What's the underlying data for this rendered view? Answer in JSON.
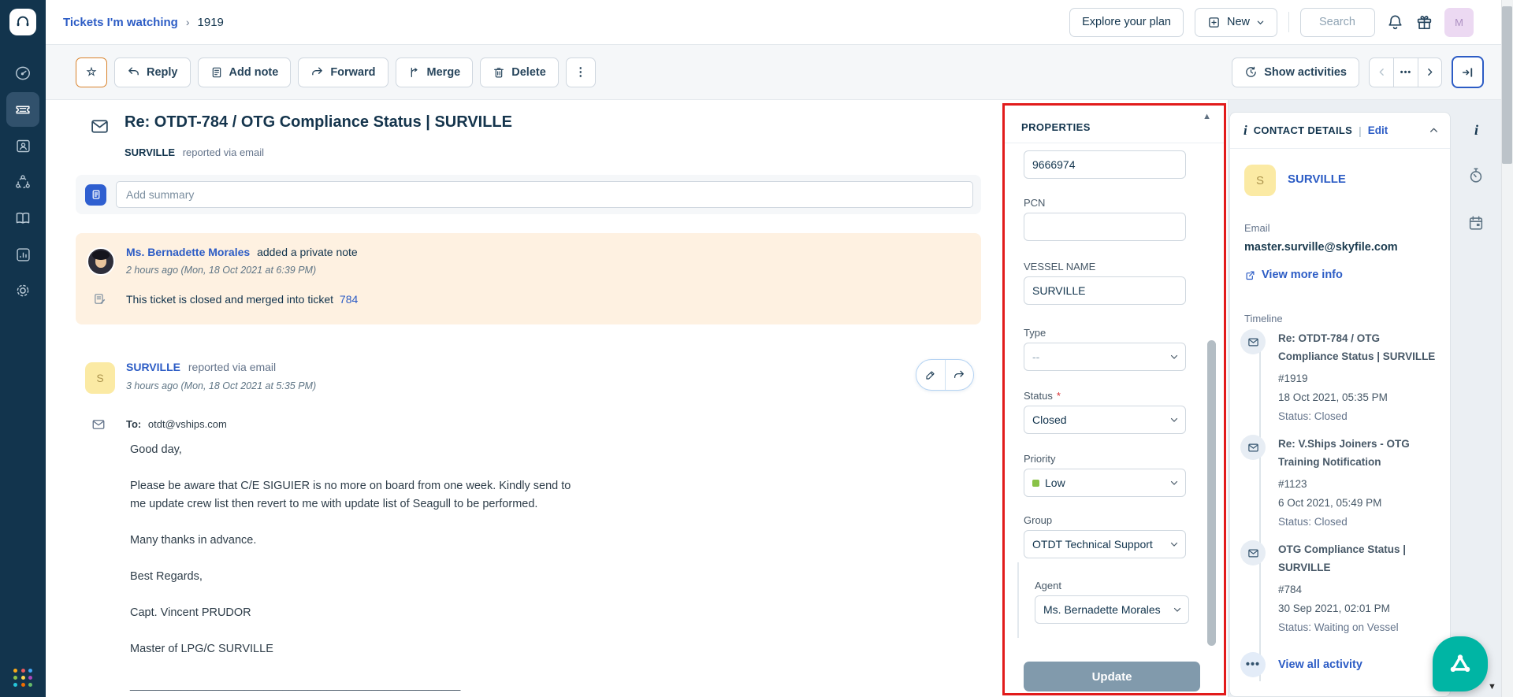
{
  "topbar": {
    "breadcrumb_parent": "Tickets I'm watching",
    "breadcrumb_separator": "›",
    "breadcrumb_current": "1919",
    "explore_plan_label": "Explore your plan",
    "new_label": "New",
    "search_placeholder": "Search",
    "avatar_initial": "M"
  },
  "toolbar": {
    "star_glyph": "☆",
    "reply_label": "Reply",
    "add_note_label": "Add note",
    "forward_label": "Forward",
    "merge_label": "Merge",
    "delete_label": "Delete",
    "kebab_glyph": "⋮",
    "show_activities_label": "Show activities",
    "ellipsis_glyph": "•••"
  },
  "ticket": {
    "subject": "Re: OTDT-784 / OTG Compliance Status | SURVILLE",
    "requester": "SURVILLE",
    "via_text": "reported via email",
    "summary_placeholder": "Add summary"
  },
  "private_note": {
    "author": "Ms. Bernadette Morales",
    "action_text": "added a private note",
    "timestamp": "2 hours ago (Mon, 18 Oct 2021 at 6:39 PM)",
    "body_text": "This ticket is closed and merged into ticket",
    "merged_ticket_link": "784"
  },
  "conversation": {
    "author": "SURVILLE",
    "avatar_initial": "S",
    "via_text": "reported via email",
    "timestamp": "3 hours ago (Mon, 18 Oct 2021 at 5:35 PM)",
    "to_label": "To:",
    "to_value": "otdt@vships.com",
    "body": [
      "Good day,",
      "Please be aware that C/E SIGUIER is no more on board from one week. Kindly send to me update crew list then revert to me with update list of Seagull to be performed.",
      "Many thanks in advance.",
      "Best Regards,",
      "Capt. Vincent PRUDOR",
      "Master of LPG/C SURVILLE"
    ],
    "signature_divider": "____________________________________________________"
  },
  "properties": {
    "title": "PROPERTIES",
    "scroll_up_glyph": "▲",
    "imo_value": "9666974",
    "pcn_label": "PCN",
    "pcn_value": "",
    "vessel_label": "VESSEL NAME",
    "vessel_value": "SURVILLE",
    "type_label": "Type",
    "type_value": "--",
    "status_label": "Status",
    "required_marker": "*",
    "status_value": "Closed",
    "priority_label": "Priority",
    "priority_value": "Low",
    "priority_color": "#89c247",
    "group_label": "Group",
    "group_value": "OTDT Technical Support",
    "agent_label": "Agent",
    "agent_value": "Ms. Bernadette Morales",
    "update_label": "Update"
  },
  "contact": {
    "info_glyph": "i",
    "title": "CONTACT DETAILS",
    "separator": "|",
    "edit_label": "Edit",
    "name": "SURVILLE",
    "avatar_initial": "S",
    "email_label": "Email",
    "email_value": "master.surville@skyfile.com",
    "view_more_label": "View more info"
  },
  "timeline": {
    "title": "Timeline",
    "items": [
      {
        "title": "Re: OTDT-784 / OTG Compliance Status | SURVILLE",
        "ticket_id": "#1919",
        "date": "18 Oct 2021, 05:35 PM",
        "status": "Status: Closed"
      },
      {
        "title": "Re: V.Ships Joiners - OTG Training Notification",
        "ticket_id": "#1123",
        "date": "6 Oct 2021, 05:49 PM",
        "status": "Status: Closed"
      },
      {
        "title": "OTG Compliance Status | SURVILLE",
        "ticket_id": "#784",
        "date": "30 Sep 2021, 02:01 PM",
        "status": "Status: Waiting on Vessel"
      }
    ],
    "view_all_label": "View all activity"
  },
  "colors": {
    "sidebar_navy": "#12344d",
    "link_blue": "#2c5cc5",
    "note_peach": "#fef1e1",
    "annotation_red": "#e21b1b",
    "chat_teal": "#00b5a4",
    "update_disabled": "#819aac"
  }
}
